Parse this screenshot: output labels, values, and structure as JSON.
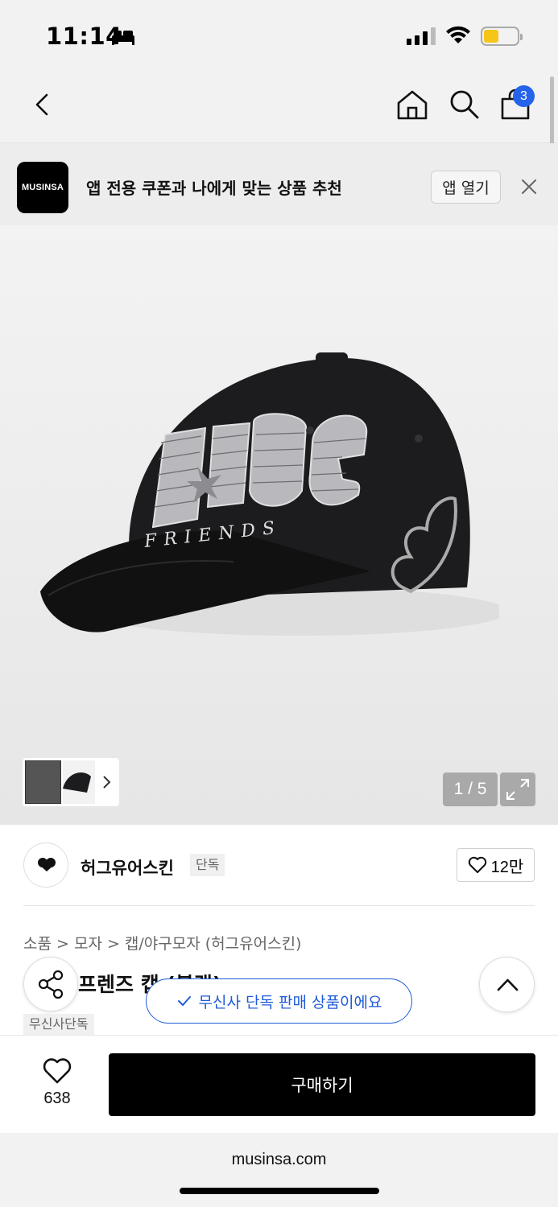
{
  "status_bar": {
    "time": "11:14"
  },
  "nav": {
    "cart_count": "3"
  },
  "banner": {
    "logo_text": "MUSINSA",
    "message": "앱 전용 쿠폰과 나에게 맞는 상품 추천",
    "open_label": "앱 열기"
  },
  "gallery": {
    "counter": "1 / 5"
  },
  "brand": {
    "name": "허그유어스킨",
    "exclusive_tag": "단독",
    "likes": "12만"
  },
  "product": {
    "breadcrumb": "소품 > 모자 > 캡/야구모자 (허그유어스킨)",
    "title_visible": "프렌즈 캡 (블랙)",
    "tag": "무신사단독"
  },
  "toast": {
    "message": "무신사 단독 판매 상품이에요"
  },
  "bottom_bar": {
    "wish_count": "638",
    "buy_label": "구매하기"
  },
  "browser": {
    "url": "musinsa.com"
  },
  "colors": {
    "accent": "#1e5bd8",
    "badge": "#2563eb",
    "buy_button": "#000000"
  }
}
